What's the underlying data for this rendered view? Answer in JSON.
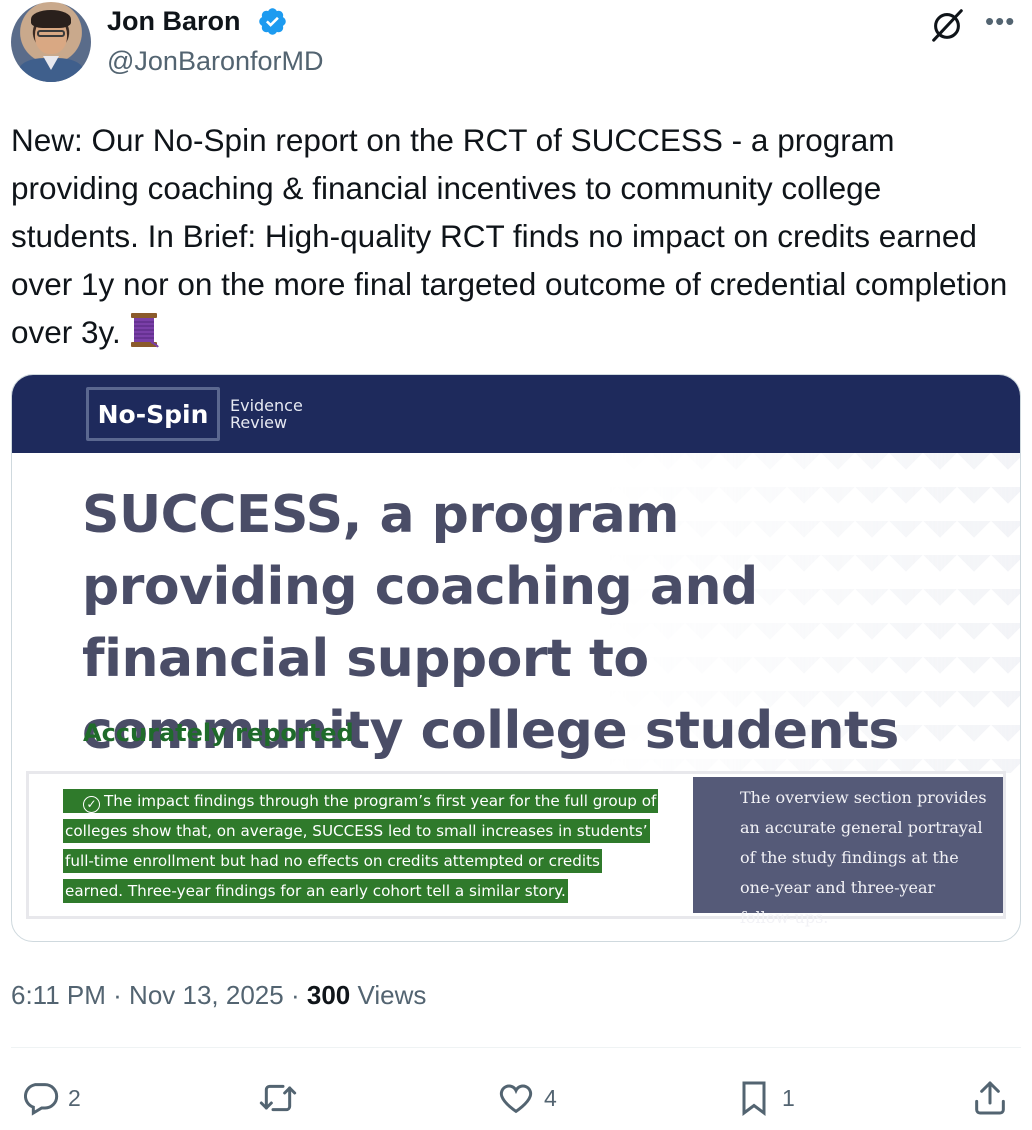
{
  "author": {
    "name": "Jon Baron",
    "handle": "@JonBaronforMD"
  },
  "tweet": {
    "text": "New: Our No-Spin report on the RCT of SUCCESS - a program providing coaching & financial incentives to community college students. In Brief: High-quality RCT finds no impact on credits earned over 1y nor on the more final targeted outcome of credential completion over 3y."
  },
  "media": {
    "logo_text": "No-Spin",
    "logo_sub_1": "Evidence",
    "logo_sub_2": "Review",
    "title": "SUCCESS, a program providing coaching and financial support to community college students",
    "verdict": "Accurately reported",
    "quote_check": "✓",
    "quote_line1": "The impact findings through the program’s first year for the full group of",
    "quote_line2": "colleges show that, on average, SUCCESS led to small increases in students’",
    "quote_line3": "full-time enrollment but had no effects on credits attempted or credits",
    "quote_line4": "earned. Three-year findings for an early cohort tell a similar story.",
    "sidebar_text": "The overview section provides an accurate general portrayal of the study findings at the one-year and three-year follow-ups.",
    "colors": {
      "banner": "#1e2a5c",
      "title": "#4a4d67",
      "verdict": "#1f6b2a",
      "highlight": "#2f7a2b",
      "sidebar": "#555a78"
    }
  },
  "meta": {
    "time": "6:11 PM",
    "separator": "·",
    "date": "Nov 13, 2025",
    "views_count": "300",
    "views_label": "Views"
  },
  "actions": {
    "reply_count": "2",
    "retweet_count": "",
    "like_count": "4",
    "bookmark_count": "1"
  },
  "icons": [
    "verified-badge-icon",
    "grok-icon",
    "more-icon",
    "spool-emoji-icon",
    "reply-icon",
    "retweet-icon",
    "like-icon",
    "bookmark-icon",
    "share-icon"
  ]
}
